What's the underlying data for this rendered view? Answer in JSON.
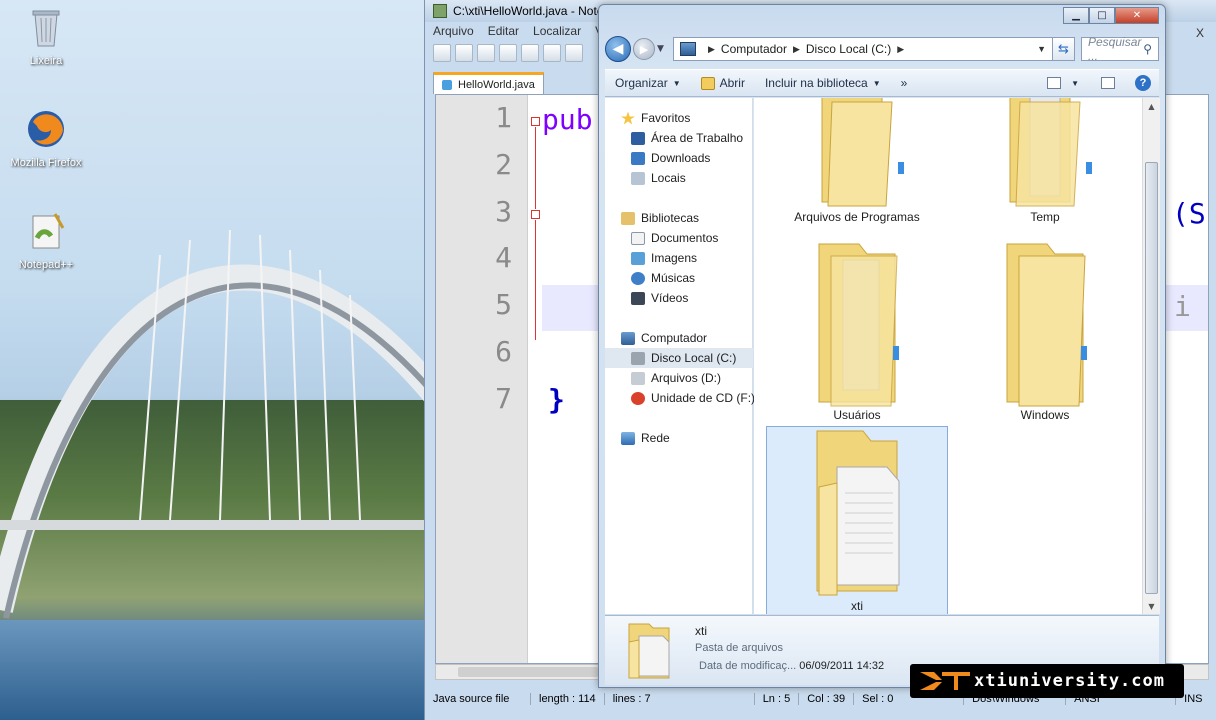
{
  "desktop": {
    "icons": [
      {
        "label": "Lixeira",
        "icon": "recycle-bin-icon"
      },
      {
        "label": "Mozilla Firefox",
        "icon": "firefox-icon"
      },
      {
        "label": "Notepad++",
        "icon": "notepadpp-icon"
      }
    ]
  },
  "notepad": {
    "title": "C:\\xti\\HelloWorld.java - Notepad++",
    "menu": [
      "Arquivo",
      "Editar",
      "Localizar",
      "V"
    ],
    "close_glyph": "X",
    "tab_label": "HelloWorld.java",
    "line_numbers": [
      "1",
      "2",
      "3",
      "4",
      "5",
      "6",
      "7"
    ],
    "code": {
      "line1": "pub",
      "line3": "(S",
      "line5": "i",
      "line7": "}"
    },
    "status": {
      "type": "Java source file",
      "length": "length : 114",
      "lines": "lines : 7",
      "ln": "Ln : 5",
      "col": "Col : 39",
      "sel": "Sel : 0",
      "eol": "Dos\\Windows",
      "encoding": "ANSI",
      "mode": "INS"
    }
  },
  "explorer": {
    "breadcrumb": [
      "Computador",
      "Disco Local (C:)"
    ],
    "search_placeholder": "Pesquisar ...",
    "commands": {
      "organize": "Organizar",
      "open": "Abrir",
      "library": "Incluir na biblioteca",
      "more": "»"
    },
    "nav": {
      "favorites": "Favoritos",
      "desktop": "Área de Trabalho",
      "downloads": "Downloads",
      "places": "Locais",
      "libraries": "Bibliotecas",
      "documents": "Documentos",
      "images": "Imagens",
      "music": "Músicas",
      "videos": "Vídeos",
      "computer": "Computador",
      "drive_c": "Disco Local (C:)",
      "drive_d": "Arquivos (D:)",
      "drive_f": "Unidade de CD (F:)",
      "network": "Rede"
    },
    "folders": [
      "Arquivos de Programas",
      "Temp",
      "Usuários",
      "Windows",
      "xti"
    ],
    "details": {
      "name": "xti",
      "type": "Pasta de arquivos",
      "modified_label": "Data de modificaç...",
      "modified_value": "06/09/2011 14:32"
    }
  },
  "watermark": "xtiuniversity.com",
  "colors": {
    "keyword": "#8000ff",
    "brace": "#0000c0",
    "selection": "#dcebfc",
    "accent_tab": "#f5a623"
  }
}
